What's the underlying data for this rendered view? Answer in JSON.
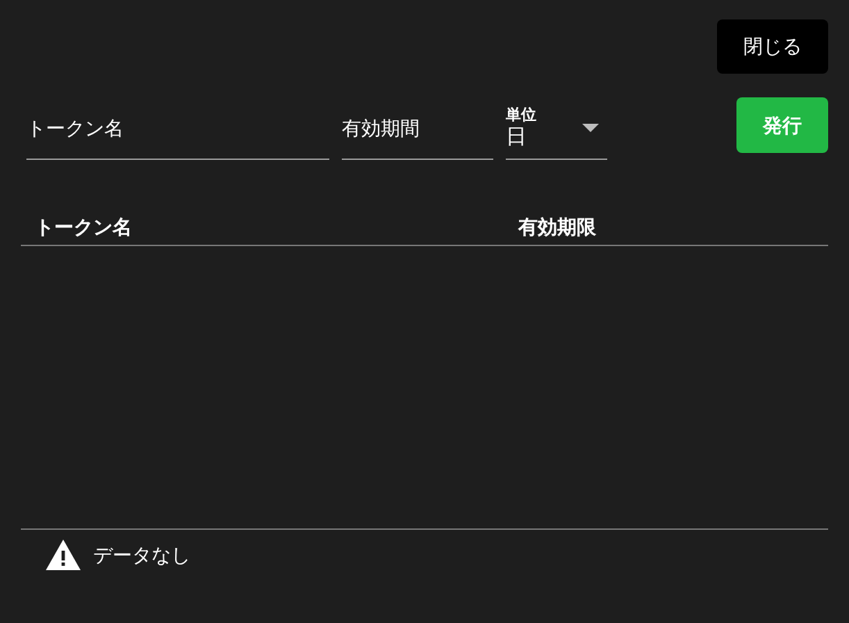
{
  "close_button": {
    "label": "閉じる"
  },
  "form": {
    "token_name": {
      "placeholder": "トークン名"
    },
    "period": {
      "placeholder": "有効期間"
    },
    "unit": {
      "label": "単位",
      "value": "日"
    },
    "issue_button": {
      "label": "発行"
    }
  },
  "table": {
    "columns": [
      "トークン名",
      "有効期限"
    ],
    "empty_message": "データなし"
  }
}
